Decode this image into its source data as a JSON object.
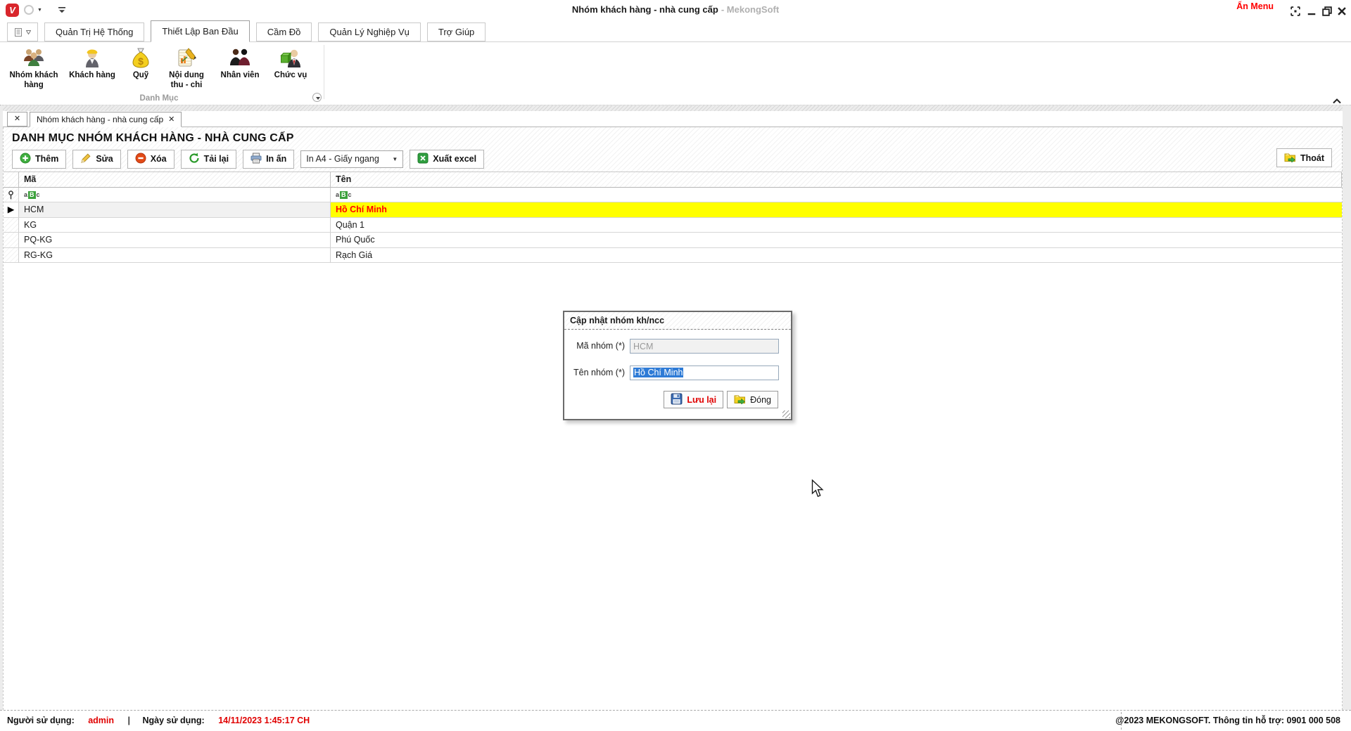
{
  "window": {
    "logo_letter": "V",
    "title_main": "Nhóm khách hàng - nhà cung cấp",
    "title_suffix": "- MekongSoft",
    "hide_menu_label": "Ẩn Menu"
  },
  "icons": {
    "close_glyph": "✕",
    "caret_down": "▼",
    "row_marker": "▶",
    "filter_abc": [
      "a",
      "B",
      "c"
    ]
  },
  "ribbon": {
    "tabs": [
      {
        "label": "Quản Trị Hệ Thống"
      },
      {
        "label": "Thiết Lập Ban Đầu"
      },
      {
        "label": "Cầm Đồ"
      },
      {
        "label": "Quản Lý Nghiệp Vụ"
      },
      {
        "label": "Trợ Giúp"
      }
    ],
    "group_label": "Danh Mục",
    "items": [
      {
        "label": "Nhóm khách hàng",
        "icon": "people-group-icon"
      },
      {
        "label": "Khách hàng",
        "icon": "customer-icon"
      },
      {
        "label": "Quỹ",
        "icon": "money-bag-icon"
      },
      {
        "label": "Nội dung thu - chi",
        "icon": "notepad-icon"
      },
      {
        "label": "Nhân viên",
        "icon": "staff-icon"
      },
      {
        "label": "Chức vụ",
        "icon": "position-icon"
      }
    ]
  },
  "doc_tabs": {
    "active_label": "Nhóm khách hàng - nhà cung cấp"
  },
  "page": {
    "title": "DANH MỤC NHÓM KHÁCH HÀNG - NHÀ CUNG CẤP"
  },
  "toolbar": {
    "add_label": "Thêm",
    "edit_label": "Sửa",
    "delete_label": "Xóa",
    "reload_label": "Tải lại",
    "print_label": "In ấn",
    "print_mode_value": "In A4 - Giấy ngang",
    "export_label": "Xuất excel",
    "exit_label": "Thoát"
  },
  "table": {
    "columns": [
      "Mã",
      "Tên"
    ],
    "rows": [
      {
        "ma": "HCM",
        "ten": "Hồ Chí Minh"
      },
      {
        "ma": "KG",
        "ten": "Quận 1"
      },
      {
        "ma": "PQ-KG",
        "ten": "Phú Quốc"
      },
      {
        "ma": "RG-KG",
        "ten": "Rạch Giá"
      }
    ]
  },
  "dialog": {
    "title": "Cập nhật nhóm kh/ncc",
    "code_label": "Mã nhóm (*)",
    "code_value": "HCM",
    "name_label": "Tên nhóm (*)",
    "name_value": "Hồ Chí Minh",
    "save_label": "Lưu lại",
    "close_label": "Đóng"
  },
  "status_bar": {
    "user_label": "Người sử dụng:",
    "user_value": "admin",
    "separator": "|",
    "date_label": "Ngày sử dụng:",
    "date_value": "14/11/2023 1:45:17 CH",
    "copyright": "@2023 MEKONGSOFT. Thông tin hỗ trợ: 0901 000 508"
  },
  "colors": {
    "accent_red": "#ff0000",
    "highlight_yellow": "#ffff00",
    "selection_blue": "#2e7bd6",
    "badge_green": "#3da13d"
  }
}
